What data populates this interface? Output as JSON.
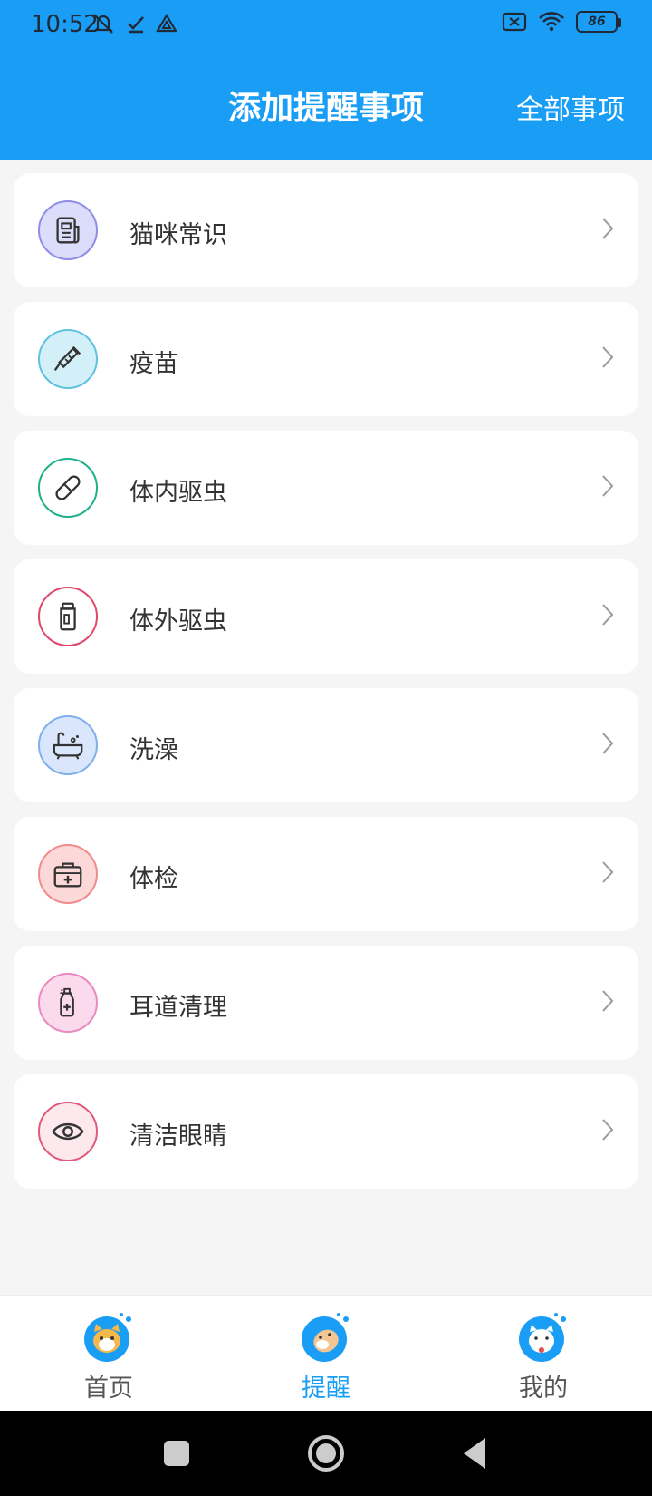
{
  "status_bar": {
    "time": "10:52",
    "battery": "86",
    "left_icons": [
      "bell-off-icon",
      "check-icon",
      "drive-icon"
    ],
    "right_icons": [
      "sim-off-icon",
      "wifi-icon",
      "battery-icon"
    ]
  },
  "header": {
    "title": "添加提醒事项",
    "action_label": "全部事项",
    "background": "#1a9df5"
  },
  "items": [
    {
      "label": "猫咪常识",
      "icon": "newspaper-icon",
      "color": "#6b6bd6",
      "bg": "#dcdcfb"
    },
    {
      "label": "疫苗",
      "icon": "syringe-icon",
      "color": "#4cb8d6",
      "bg": "#d3f0f8"
    },
    {
      "label": "体内驱虫",
      "icon": "pill-icon",
      "color": "#1eb08a",
      "bg": "#ffffff"
    },
    {
      "label": "体外驱虫",
      "icon": "bottle-icon",
      "color": "#e0476a",
      "bg": "#ffffff"
    },
    {
      "label": "洗澡",
      "icon": "bathtub-icon",
      "color": "#6aa0e8",
      "bg": "#d9e6fb"
    },
    {
      "label": "体检",
      "icon": "medical-kit-icon",
      "color": "#f08c8c",
      "bg": "#fdd8d8"
    },
    {
      "label": "耳道清理",
      "icon": "spray-bottle-icon",
      "color": "#e98ac0",
      "bg": "#fcdaee"
    },
    {
      "label": "清洁眼睛",
      "icon": "eye-icon",
      "color": "#e05a7c",
      "bg": "#fde8ee"
    }
  ],
  "tabbar": {
    "tabs": [
      {
        "label": "首页",
        "icon": "cat-home-icon",
        "active": false
      },
      {
        "label": "提醒",
        "icon": "cat-reminder-icon",
        "active": true
      },
      {
        "label": "我的",
        "icon": "cat-profile-icon",
        "active": false
      }
    ],
    "active_color": "#1a9df5"
  },
  "nav_bar": {
    "buttons": [
      "recents-button",
      "home-button",
      "back-button"
    ]
  }
}
